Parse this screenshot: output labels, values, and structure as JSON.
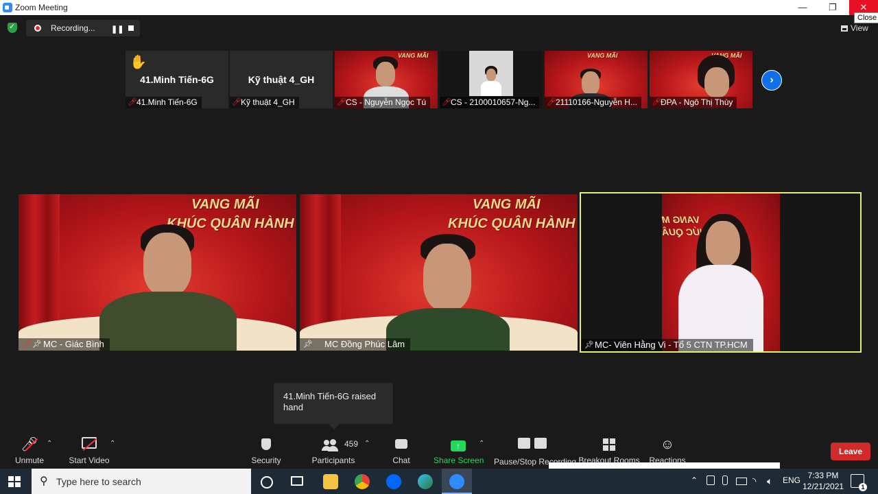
{
  "window": {
    "title": "Zoom Meeting",
    "minimize": "—",
    "restore": "❐",
    "close": "✕",
    "close_tooltip": "Close"
  },
  "top_bar": {
    "recording_label": "Recording...",
    "pause": "❚❚",
    "view_label": "View"
  },
  "strip": [
    {
      "big_label": "41.Minh Tiến-6G",
      "name": "41.Minh Tiến-6G",
      "raised_hand": "✋"
    },
    {
      "big_label": "Kỹ thuật 4_GH",
      "name": "Kỹ thuật 4_GH"
    },
    {
      "name": "CS - Nguyễn Ngọc Tú"
    },
    {
      "name": "CS - 2100010657-Ng..."
    },
    {
      "name": "21110166-Nguyễn H..."
    },
    {
      "name": "ĐPA - Ngô Thị Thùy"
    }
  ],
  "strip_next": "›",
  "banner": {
    "line1": "VANG MÃI",
    "line2": "KHÚC QUÂN HÀNH"
  },
  "banner_mirrored": {
    "line1": "VANG M",
    "line2": "KHÚC QUÂ"
  },
  "tiles": [
    {
      "name": "MC - Giác Bình"
    },
    {
      "name": "MC Đồng Phúc Lâm"
    },
    {
      "name": "MC- Viên Hằng Vi - Tổ 5 CTN TP.HCM"
    }
  ],
  "tooltip": {
    "text": "41.Minh Tiến-6G raised hand"
  },
  "toolbar": {
    "unmute": "Unmute",
    "start_video": "Start Video",
    "security": "Security",
    "participants": "Participants",
    "participant_count": "459",
    "chat": "Chat",
    "share_screen": "Share Screen",
    "pause_stop": "Pause/Stop Recording",
    "breakout": "Breakout Rooms",
    "reactions": "Reactions",
    "leave": "Leave",
    "caret": "⌃"
  },
  "taskbar": {
    "search_placeholder": "Type here to search",
    "language": "ENG",
    "time": "7:33 PM",
    "date": "12/21/2021",
    "notifications": "1"
  },
  "colors": {
    "accent_blue": "#0e71eb",
    "active_speaker_border": "#e7ef7a",
    "share_green": "#23d959",
    "leave_red": "#d12a2a",
    "banner_red": "#b5161a"
  }
}
